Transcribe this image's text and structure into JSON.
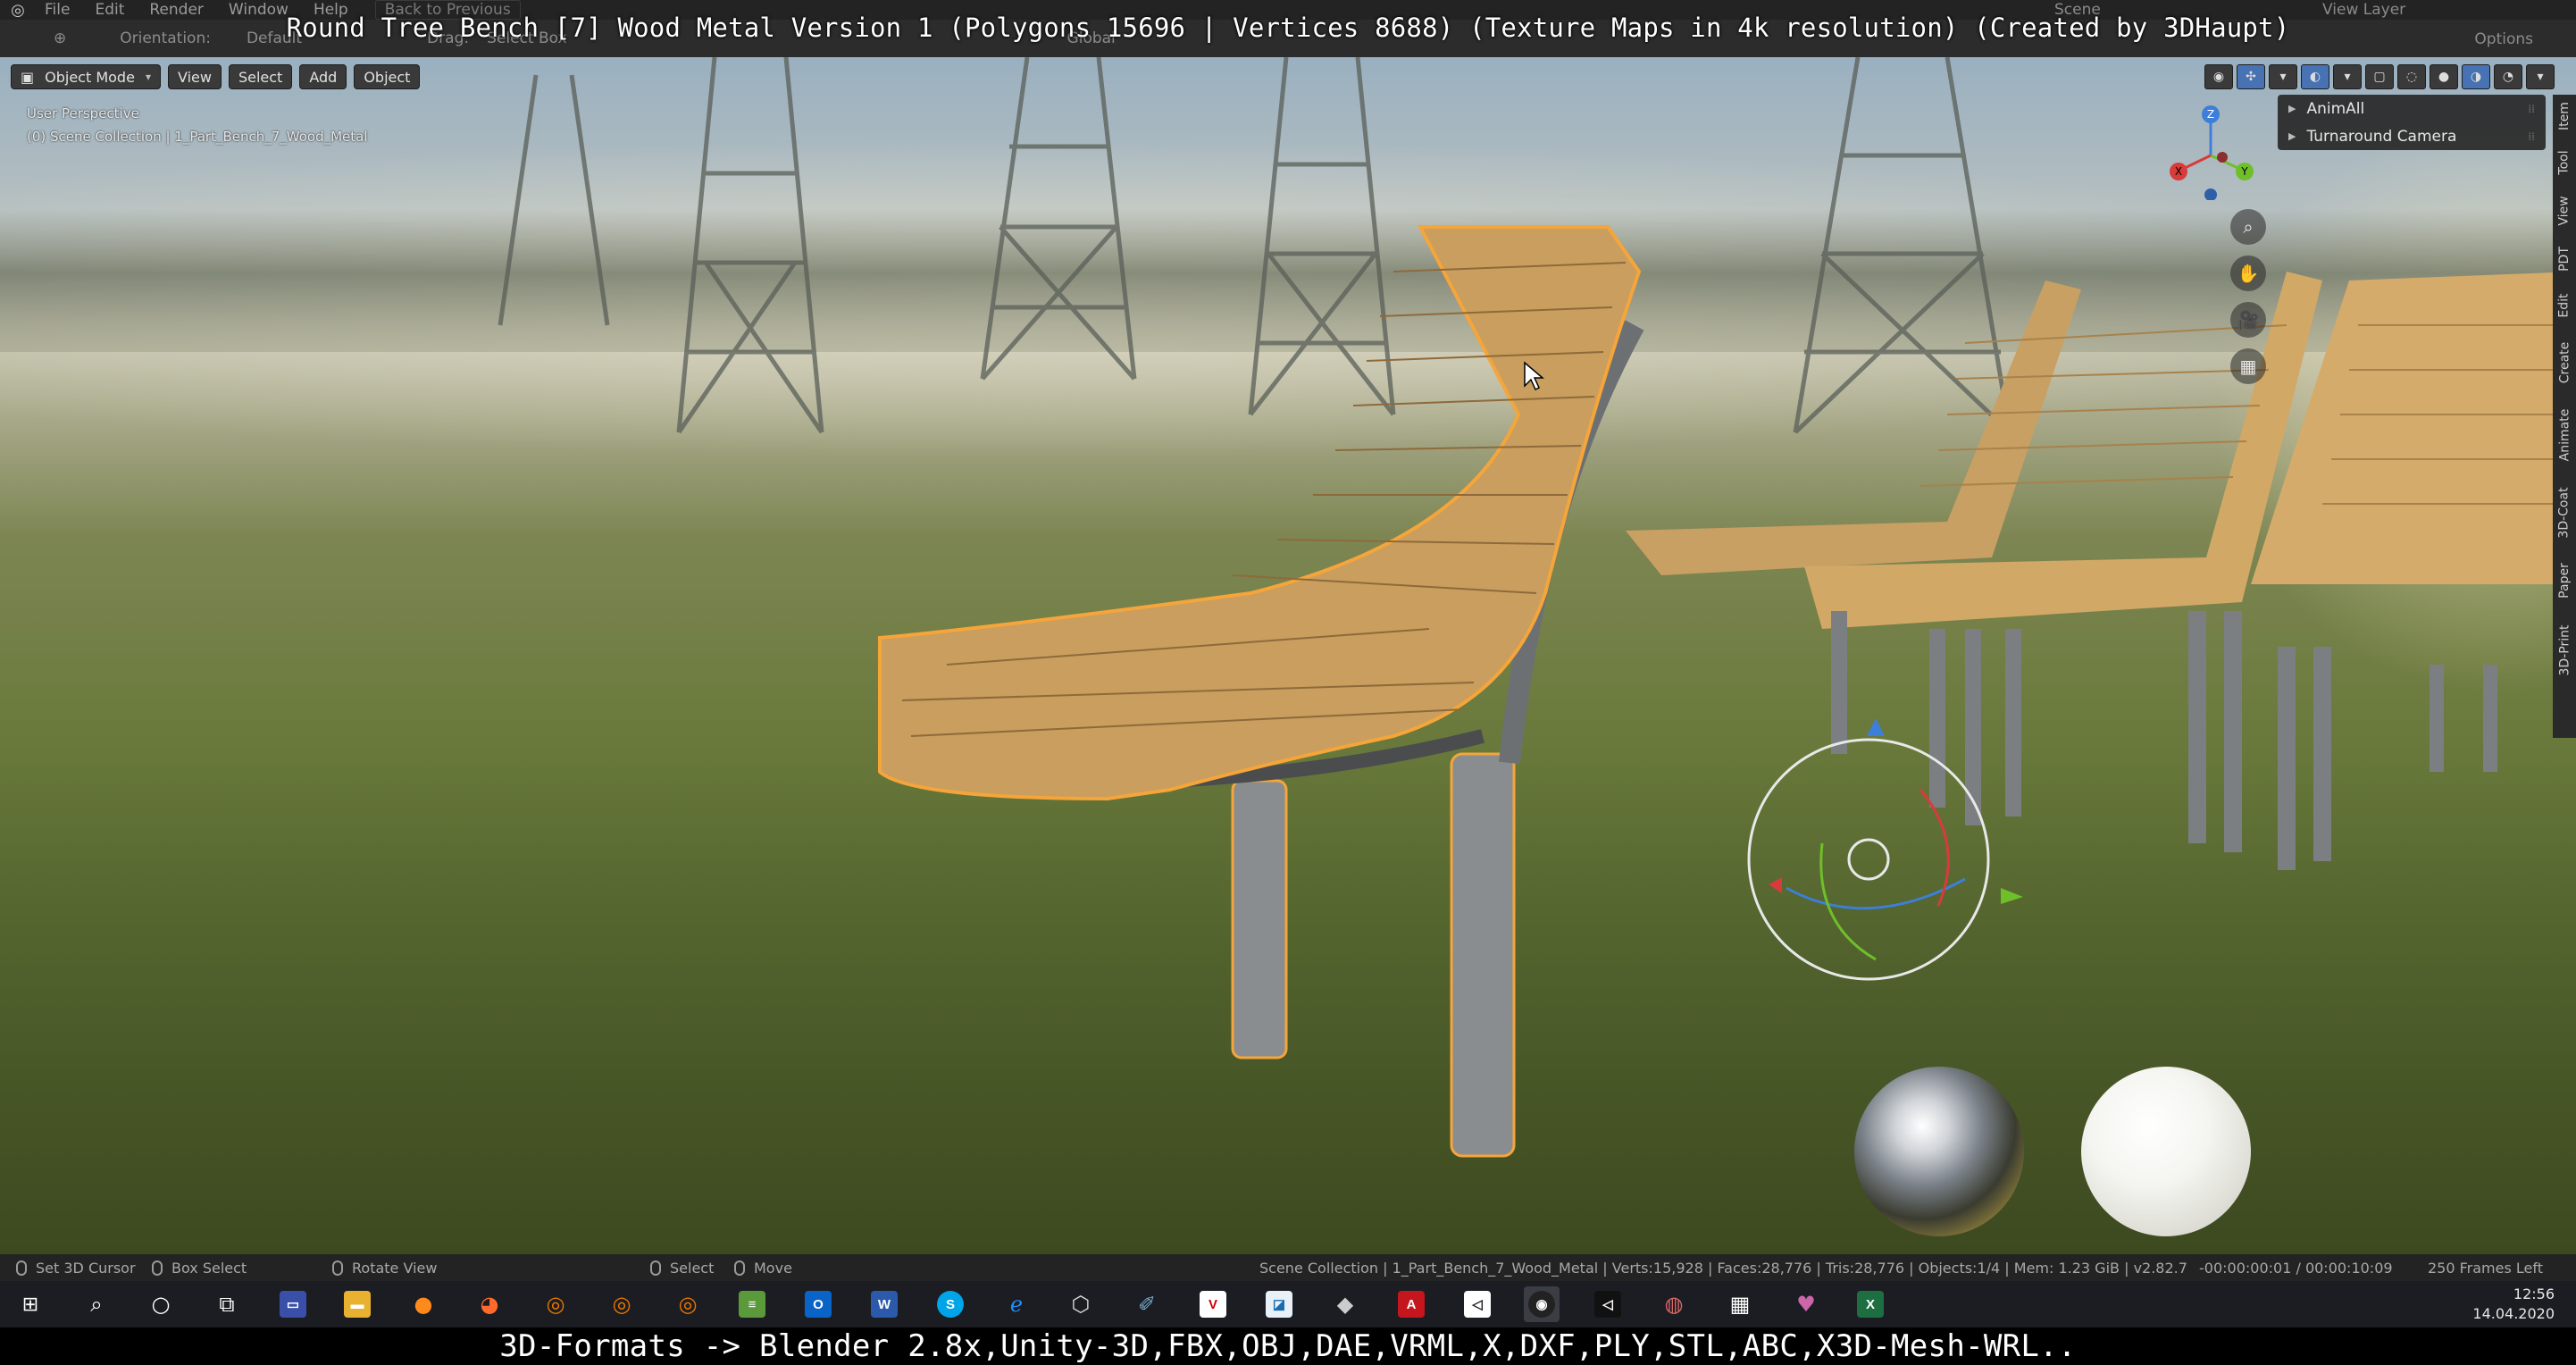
{
  "video_title": "Round Tree Bench [7] Wood Metal Version 1 (Polygons 15696 | Vertices 8688) (Texture Maps in 4k resolution) (Created by 3DHaupt)",
  "menubar": {
    "items": [
      "File",
      "Edit",
      "Render",
      "Window",
      "Help"
    ],
    "back_label": "Back to Previous",
    "scene_label": "Scene",
    "view_layer_label": "View Layer"
  },
  "tool_settings": {
    "orientation_label": "Orientation:",
    "orientation_value": "Default",
    "drag_label": "Drag:",
    "drag_value": "Select Box",
    "transform_value": "Global",
    "options_label": "Options"
  },
  "viewport": {
    "mode_label": "Object Mode",
    "menu": [
      "View",
      "Select",
      "Add",
      "Object"
    ],
    "perspective_label": "User Perspective",
    "collection_label": "(0) Scene Collection | 1_Part_Bench_7_Wood_Metal",
    "gizmo_axes": {
      "x": "X",
      "y": "Y",
      "z": "Z"
    },
    "nav_buttons": [
      {
        "icon": "zoom-icon",
        "glyph": "⌕"
      },
      {
        "icon": "pan-hand-icon",
        "glyph": "✋"
      },
      {
        "icon": "camera-icon",
        "glyph": "🎥"
      },
      {
        "icon": "grid-icon",
        "glyph": "▦"
      }
    ]
  },
  "addon_panel": {
    "items": [
      "AnimAll",
      "Turnaround Camera"
    ]
  },
  "side_tabs": [
    "Item",
    "Tool",
    "View",
    "PDT",
    "Edit",
    "Create",
    "Animate",
    "3D-Coat",
    "Paper",
    "3D-Print"
  ],
  "statusbar": {
    "set_cursor": "Set 3D Cursor",
    "box_select": "Box Select",
    "rotate_view": "Rotate View",
    "select": "Select",
    "move": "Move",
    "scene_stats": "Scene Collection | 1_Part_Bench_7_Wood_Metal | Verts:15,928 | Faces:28,776 | Tris:28,776 | Objects:1/4 | Mem: 1.23 GiB | v2.82.7",
    "time": "-00:00:00:01 / 00:00:10:09",
    "frames_left": "250 Frames Left"
  },
  "taskbar": {
    "time": "12:56",
    "date": "14.04.2020"
  },
  "caption": "3D-Formats -> Blender 2.8x,Unity-3D,FBX,OBJ,DAE,VRML,X,DXF,PLY,STL,ABC,X3D-Mesh-WRL..",
  "colors": {
    "accent": "#4772b3",
    "selection_outline": "#f5a53a",
    "wood": "#c9a063",
    "metal": "#8a8d90"
  }
}
